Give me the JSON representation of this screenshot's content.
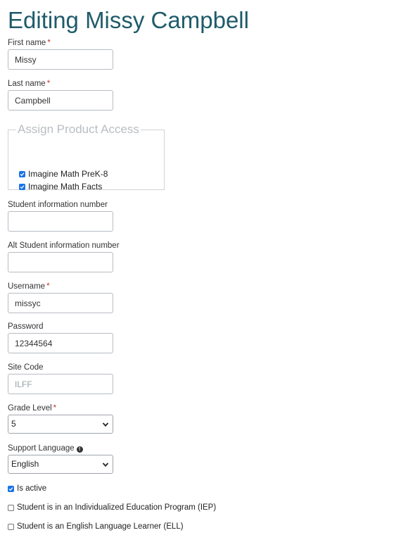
{
  "page": {
    "title": "Editing Missy Campbell"
  },
  "form": {
    "first_name": {
      "label": "First name",
      "required_mark": "*",
      "value": "Missy"
    },
    "last_name": {
      "label": "Last name",
      "required_mark": "*",
      "value": "Campbell"
    },
    "product_access": {
      "legend": "Assign Product Access",
      "products": [
        {
          "label": "Imagine Math PreK-8",
          "checked": true
        },
        {
          "label": "Imagine Math Facts",
          "checked": true
        }
      ]
    },
    "student_info_number": {
      "label": "Student information number",
      "value": ""
    },
    "alt_student_info_number": {
      "label": "Alt Student information number",
      "value": ""
    },
    "username": {
      "label": "Username",
      "required_mark": "*",
      "value": "missyc"
    },
    "password": {
      "label": "Password",
      "value": "12344564"
    },
    "site_code": {
      "label": "Site Code",
      "value": "ILFF"
    },
    "grade_level": {
      "label": "Grade Level",
      "required_mark": "*",
      "selected": "5"
    },
    "support_language": {
      "label": "Support Language",
      "info_icon": "info-icon",
      "selected": "English"
    },
    "checkboxes": {
      "is_active": {
        "label": "Is active",
        "checked": true
      },
      "iep": {
        "label": "Student is in an Individualized Education Program (IEP)",
        "checked": false
      },
      "ell": {
        "label": "Student is an English Language Learner (ELL)",
        "checked": false
      }
    }
  },
  "colors": {
    "title": "#1f5b6a",
    "required": "#c0392b",
    "checkbox": "#1a73e8",
    "legend": "#b9bec3"
  }
}
